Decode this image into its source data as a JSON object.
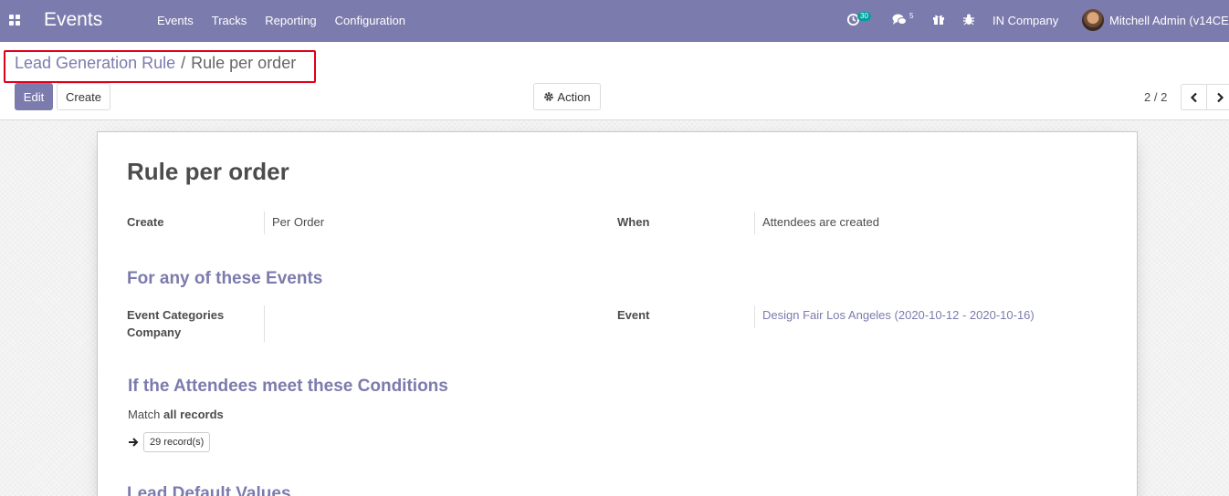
{
  "navbar": {
    "app_name": "Events",
    "menu": [
      "Events",
      "Tracks",
      "Reporting",
      "Configuration"
    ],
    "activity_count": "30",
    "message_count": "5",
    "company": "IN Company",
    "user": "Mitchell Admin (v14CE",
    "color": "#7c7bad"
  },
  "breadcrumb": {
    "parent": "Lead Generation Rule",
    "separator": "/",
    "current": "Rule per order"
  },
  "buttons": {
    "edit": "Edit",
    "create": "Create",
    "action": "Action"
  },
  "pager": {
    "value": "2 / 2"
  },
  "form": {
    "title": "Rule per order",
    "create_label": "Create",
    "create_value": "Per Order",
    "when_label": "When",
    "when_value": "Attendees are created",
    "section_events": "For any of these Events",
    "categories_label": "Event Categories",
    "company_label": "Company",
    "event_label": "Event",
    "event_value": "Design Fair Los Angeles (2020-10-12 - 2020-10-16)",
    "section_conditions": "If the Attendees meet these Conditions",
    "match_prefix": "Match",
    "match_value": "all records",
    "records_button": "29 record(s)",
    "section_defaults": "Lead Default Values"
  },
  "icons": {
    "apps": "apps-grid-icon",
    "activity": "clock-icon",
    "messages": "chat-bubbles-icon",
    "gift": "gift-icon",
    "debug": "bug-icon",
    "action": "gear-icon",
    "prev": "chevron-left-icon",
    "next": "chevron-right-icon",
    "arrow": "arrow-right-icon"
  }
}
